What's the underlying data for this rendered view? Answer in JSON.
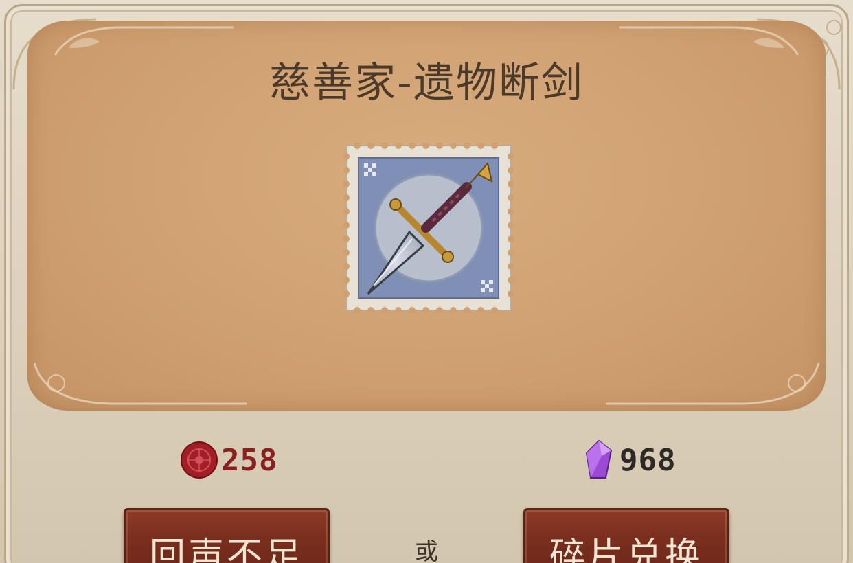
{
  "item": {
    "title": "慈善家-遗物断剑",
    "icon": "dagger-stamp-icon"
  },
  "currencies": {
    "echo": {
      "icon": "red-wax-seal-icon",
      "amount": "258",
      "color": "#8a1f1f"
    },
    "shard": {
      "icon": "purple-crystal-icon",
      "amount": "968",
      "color": "#2d2a28"
    }
  },
  "actions": {
    "echo_button_label": "回声不足",
    "separator": "或",
    "shard_button_label": "碎片兑换"
  },
  "colors": {
    "panel": "#cfa072",
    "button": "#7a2e1e",
    "frame": "#e6ddcc"
  }
}
